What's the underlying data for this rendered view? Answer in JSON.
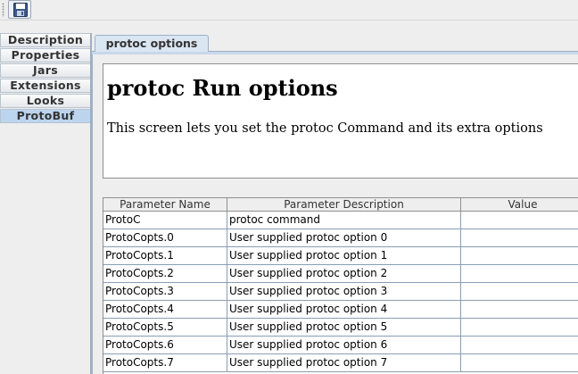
{
  "toolbar": {
    "save_icon": "floppy-disk-icon"
  },
  "nav": {
    "items": [
      {
        "label": "Description"
      },
      {
        "label": "Properties"
      },
      {
        "label": "Jars"
      },
      {
        "label": "Extensions"
      },
      {
        "label": "Looks"
      },
      {
        "label": "ProtoBuf",
        "selected": true
      }
    ]
  },
  "tab": {
    "label": "protoc options"
  },
  "header": {
    "title": "protoc Run options",
    "description": "This screen lets you set the protoc Command and its extra options"
  },
  "table": {
    "columns": [
      "Parameter Name",
      "Parameter Description",
      "Value"
    ],
    "rows": [
      {
        "name": "ProtoC",
        "description": "protoc command",
        "value": ""
      },
      {
        "name": "ProtoCopts.0",
        "description": "User supplied protoc option 0",
        "value": ""
      },
      {
        "name": "ProtoCopts.1",
        "description": "User supplied protoc option 1",
        "value": ""
      },
      {
        "name": "ProtoCopts.2",
        "description": "User supplied protoc option 2",
        "value": ""
      },
      {
        "name": "ProtoCopts.3",
        "description": "User supplied protoc option 3",
        "value": ""
      },
      {
        "name": "ProtoCopts.4",
        "description": "User supplied protoc option 4",
        "value": ""
      },
      {
        "name": "ProtoCopts.5",
        "description": "User supplied protoc option 5",
        "value": ""
      },
      {
        "name": "ProtoCopts.6",
        "description": "User supplied protoc option 6",
        "value": ""
      },
      {
        "name": "ProtoCopts.7",
        "description": "User supplied protoc option 7",
        "value": ""
      }
    ]
  },
  "colors": {
    "selected_nav": "#bcd4ee",
    "tab_bg": "#dbe6f3",
    "border": "#9eb0c6"
  }
}
